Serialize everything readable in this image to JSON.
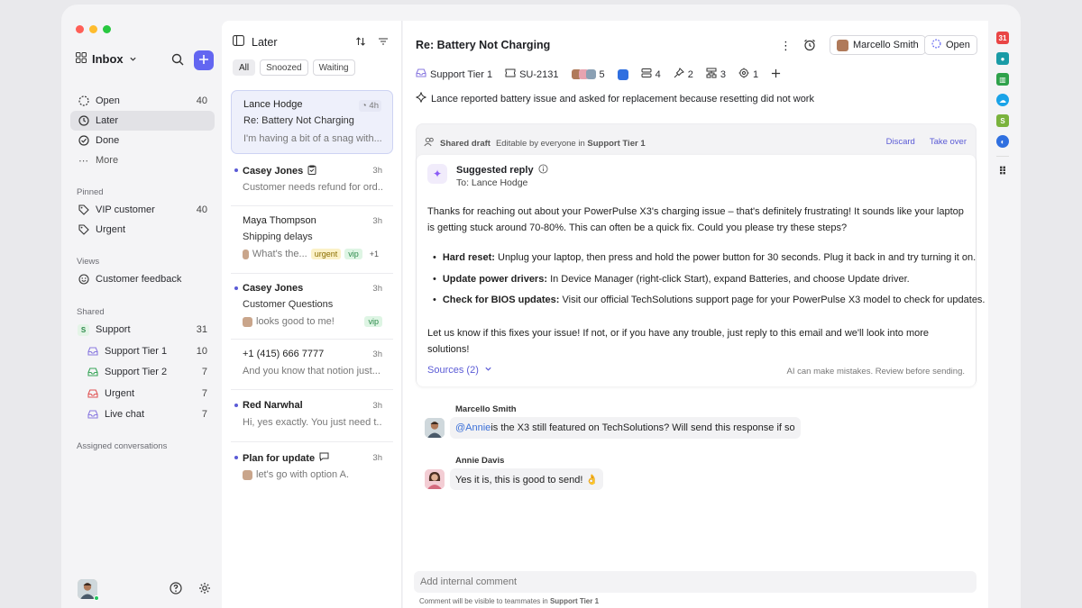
{
  "sidebar": {
    "title": "Inbox",
    "nav": [
      {
        "label": "Open",
        "count": "40"
      },
      {
        "label": "Later",
        "count": ""
      },
      {
        "label": "Done",
        "count": ""
      },
      {
        "label": "More",
        "count": ""
      }
    ],
    "pinned_label": "Pinned",
    "pinned": [
      {
        "label": "VIP customer",
        "count": "40"
      },
      {
        "label": "Urgent",
        "count": ""
      }
    ],
    "views_label": "Views",
    "views": [
      {
        "label": "Customer feedback"
      }
    ],
    "shared_label": "Shared",
    "shared": [
      {
        "label": "Support",
        "count": "31",
        "badge": "S"
      },
      {
        "label": "Support Tier 1",
        "count": "10"
      },
      {
        "label": "Support Tier 2",
        "count": "7"
      },
      {
        "label": "Urgent",
        "count": "7"
      },
      {
        "label": "Live chat",
        "count": "7"
      }
    ],
    "assigned_label": "Assigned conversations"
  },
  "list": {
    "title": "Later",
    "filters": [
      "All",
      "Snoozed",
      "Waiting"
    ],
    "items": [
      {
        "name": "Lance Hodge",
        "time": "4h",
        "subject": "Re: Battery Not Charging",
        "preview": "I'm having a bit of a snag with..."
      },
      {
        "name": "Casey Jones",
        "time": "3h",
        "preview": "Customer needs refund for ord..."
      },
      {
        "name": "Maya Thompson",
        "time": "3h",
        "subject": "Shipping delays",
        "preview": "What's the...",
        "tags": [
          "urgent",
          "vip",
          "+1"
        ]
      },
      {
        "name": "Casey Jones",
        "time": "3h",
        "subject": "Customer Questions",
        "preview": "looks good to me!",
        "tags": [
          "vip"
        ]
      },
      {
        "name": "+1 (415) 666 7777",
        "time": "3h",
        "preview": "And you know that notion just..."
      },
      {
        "name": "Red Narwhal",
        "time": "3h",
        "preview": "Hi, yes exactly. You just need t..."
      },
      {
        "name": "Plan for update",
        "time": "3h",
        "preview": "let's go with option A."
      }
    ]
  },
  "main": {
    "title": "Re: Battery Not Charging",
    "assignee": "Marcello Smith",
    "status": "Open",
    "meta": {
      "team": "Support Tier 1",
      "ticket": "SU-2131",
      "participants": "5",
      "m1": "4",
      "pins": "2",
      "m3": "3",
      "m4": "1"
    },
    "summary": "Lance reported battery issue and asked for replacement because resetting did not work",
    "draft": {
      "label": "Shared draft",
      "editable_prefix": "Editable by everyone in",
      "editable_team": "Support Tier 1",
      "discard": "Discard",
      "take_over": "Take over",
      "title": "Suggested reply",
      "to": "To: Lance Hodge",
      "p1": "Thanks for reaching out about your PowerPulse X3's charging issue – that's definitely frustrating! It sounds like your laptop is getting stuck around 70-80%. This can often be a quick fix. Could you please try these steps?",
      "bullets": [
        {
          "bold": "Hard reset:",
          "text": "Unplug your laptop, then press and hold the power button for 30 seconds. Plug it back in and try turning it on."
        },
        {
          "bold": "Update power drivers:",
          "text": "In Device Manager (right-click Start), expand Batteries, and choose Update driver."
        },
        {
          "bold": "Check for BIOS updates:",
          "text": "Visit our official TechSolutions support page for your PowerPulse X3 model to check for updates."
        }
      ],
      "p2": "Let us know if this fixes your issue! If not, or if you have any trouble, just reply to this email and we'll look into more solutions!",
      "sources": "Sources (2)",
      "disclaimer": "AI can make mistakes. Review before sending."
    },
    "messages": [
      {
        "name": "Marcello Smith",
        "mention": "@Annie",
        "text": " is the X3 still featured on TechSolutions? Will send this response if so"
      },
      {
        "name": "Annie Davis",
        "text": "Yes it is, this is good to send! 👌"
      }
    ],
    "comment_placeholder": "Add internal comment",
    "comment_note_prefix": "Comment will be visible to teammates in",
    "comment_note_team": "Support Tier 1"
  },
  "colors": {
    "accent": "#6366f1",
    "frame": "#f4f4f6"
  }
}
